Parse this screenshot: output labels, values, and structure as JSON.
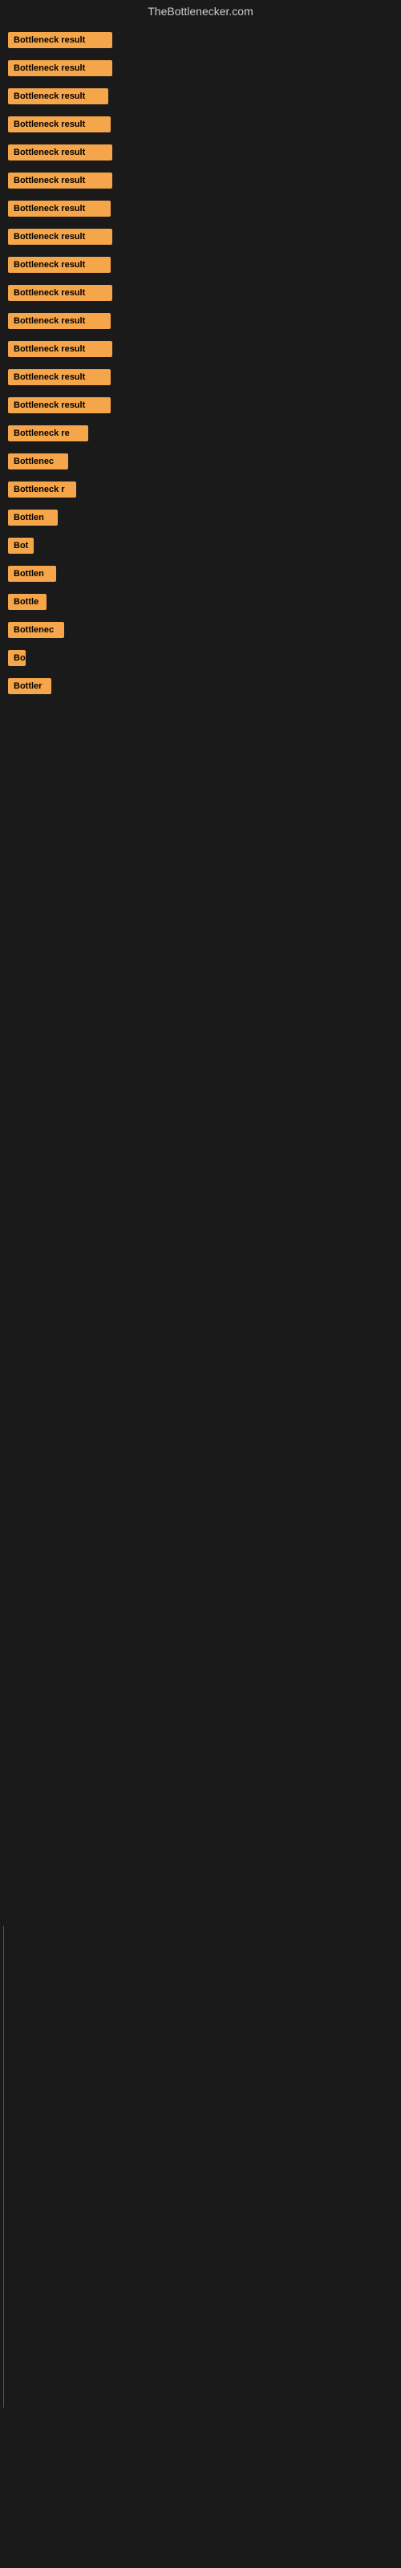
{
  "site": {
    "title": "TheBottlenecker.com"
  },
  "bars": [
    {
      "label": "Bottleneck result",
      "width": 130
    },
    {
      "label": "Bottleneck result",
      "width": 130
    },
    {
      "label": "Bottleneck result",
      "width": 125
    },
    {
      "label": "Bottleneck result",
      "width": 128
    },
    {
      "label": "Bottleneck result",
      "width": 130
    },
    {
      "label": "Bottleneck result",
      "width": 130
    },
    {
      "label": "Bottleneck result",
      "width": 128
    },
    {
      "label": "Bottleneck result",
      "width": 130
    },
    {
      "label": "Bottleneck result",
      "width": 128
    },
    {
      "label": "Bottleneck result",
      "width": 130
    },
    {
      "label": "Bottleneck result",
      "width": 128
    },
    {
      "label": "Bottleneck result",
      "width": 130
    },
    {
      "label": "Bottleneck result",
      "width": 128
    },
    {
      "label": "Bottleneck result",
      "width": 128
    },
    {
      "label": "Bottleneck re",
      "width": 100
    },
    {
      "label": "Bottlenec",
      "width": 75
    },
    {
      "label": "Bottleneck r",
      "width": 85
    },
    {
      "label": "Bottlen",
      "width": 62
    },
    {
      "label": "Bot",
      "width": 32
    },
    {
      "label": "Bottlen",
      "width": 60
    },
    {
      "label": "Bottle",
      "width": 48
    },
    {
      "label": "Bottlenec",
      "width": 70
    },
    {
      "label": "Bo",
      "width": 22
    },
    {
      "label": "Bottler",
      "width": 54
    }
  ]
}
